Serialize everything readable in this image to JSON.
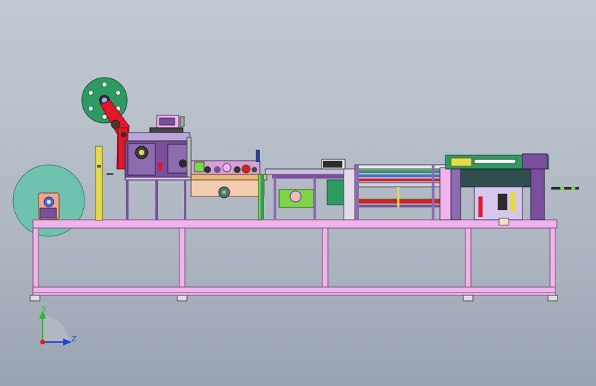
{
  "view": {
    "axes": {
      "y_label": "Y",
      "z_label": "Z"
    },
    "colors": {
      "frame": "#f0b4ec",
      "frame_edge": "#7a4c78",
      "reel_fill": "#6fc2ad",
      "reel_dark": "#2f7a67",
      "wheel_green": "#2c9a62",
      "red_arm": "#e0182a",
      "purple_block": "#7a4f9c",
      "yellow_post": "#e6d94a",
      "peach_plate": "#f4cdb0",
      "lime_part": "#7fd44a",
      "axis_y": "#2fb52f",
      "axis_z": "#1f3fd8",
      "origin": "#e01818"
    }
  }
}
